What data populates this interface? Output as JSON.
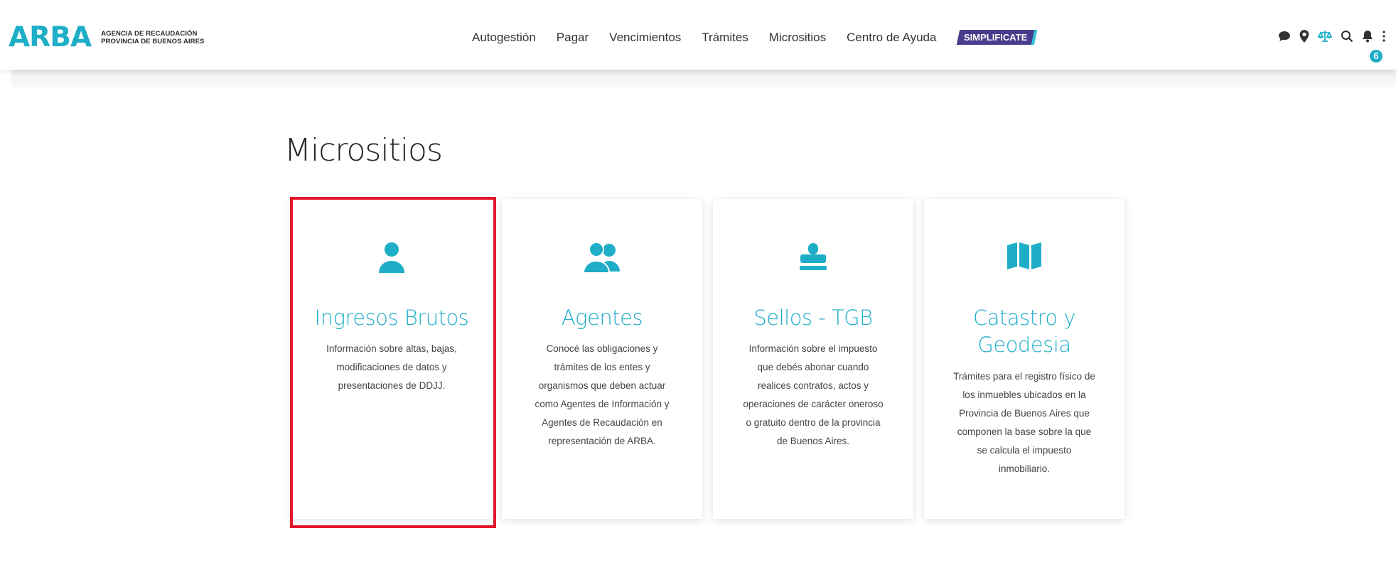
{
  "header": {
    "logo": "ARBA",
    "logo_sub_line1": "AGENCIA DE RECAUDACIÓN",
    "logo_sub_line2": "PROVINCIA DE BUENOS AIRES",
    "nav": [
      {
        "label": "Autogestión"
      },
      {
        "label": "Pagar"
      },
      {
        "label": "Vencimientos"
      },
      {
        "label": "Trámites"
      },
      {
        "label": "Micrositios"
      },
      {
        "label": "Centro de Ayuda"
      },
      {
        "label": "SIMPLIFICATE"
      }
    ],
    "utility_icons": [
      "chat-icon",
      "location-icon",
      "balance-icon",
      "search-icon",
      "bell-icon"
    ],
    "notification_count": "6"
  },
  "page": {
    "title": "Micrositios"
  },
  "cards": [
    {
      "icon": "user-icon",
      "title": "Ingresos Brutos",
      "desc": [
        "Información sobre altas, bajas,",
        "modificaciones de datos y",
        "presentaciones de DDJJ."
      ]
    },
    {
      "icon": "users-icon",
      "title": "Agentes",
      "desc": [
        "Conocé las obligaciones y",
        "trámites de los entes y",
        "organismos que deben actuar",
        "como Agentes de Información y",
        "Agentes de Recaudación en",
        "representación de ARBA."
      ]
    },
    {
      "icon": "stamp-icon",
      "title": "Sellos - TGB",
      "desc": [
        "Información sobre el impuesto",
        "que debés abonar cuando",
        "realices contratos, actos y",
        "operaciones de carácter oneroso",
        "o gratuito dentro de la provincia",
        "de Buenos Aires."
      ]
    },
    {
      "icon": "map-icon",
      "title_line1": "Catastro y",
      "title_line2": "Geodesia",
      "desc": [
        "Trámites para el registro físico de",
        "los inmuebles ubicados en la",
        "Provincia de Buenos Aires que",
        "componen la base sobre la que",
        "se calcula el impuesto",
        "inmobiliario."
      ]
    }
  ],
  "colors": {
    "accent": "#1eaec7",
    "highlight": "#e3172b",
    "simplificate_bg": "#4a3b8c"
  }
}
